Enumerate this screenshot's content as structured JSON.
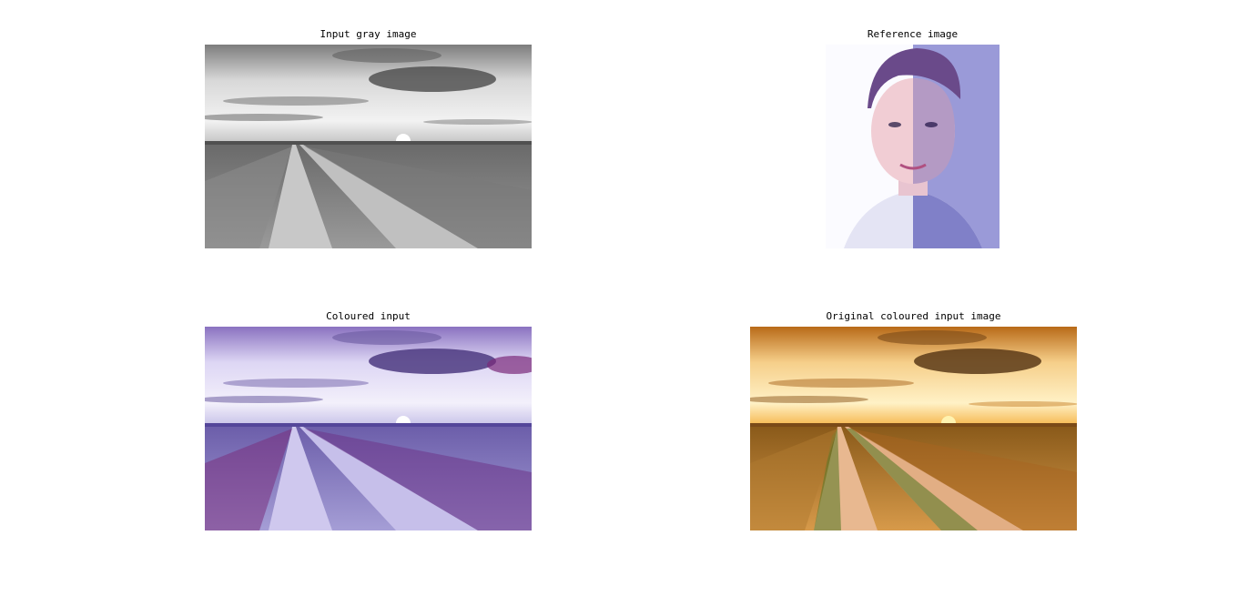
{
  "figure": {
    "panels": [
      {
        "title": "Input gray image",
        "image": "grayscale-landscape-road-sunset"
      },
      {
        "title": "Reference image",
        "image": "portrait-man-half-tinted-blue"
      },
      {
        "title": "Coloured input",
        "image": "purple-tinted-landscape-road-sunset"
      },
      {
        "title": "Original coloured input image",
        "image": "golden-landscape-road-sunset"
      }
    ]
  }
}
